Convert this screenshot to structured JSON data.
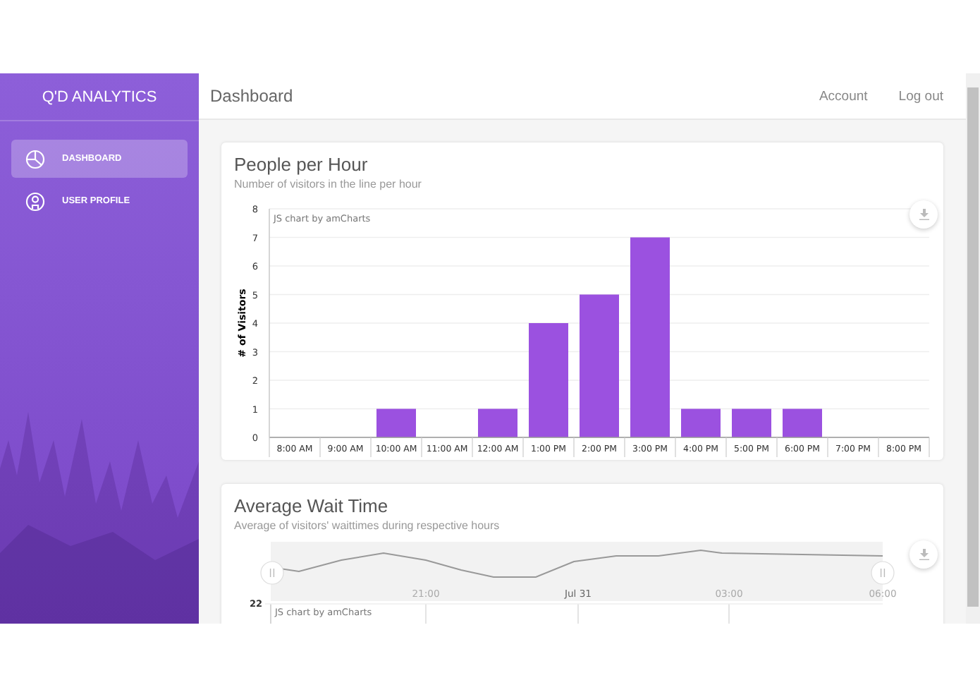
{
  "sidebar": {
    "brand": "Q'D ANALYTICS",
    "items": [
      {
        "label": "DASHBOARD",
        "kind": "pie",
        "selected": true
      },
      {
        "label": "USER PROFILE",
        "kind": "user",
        "selected": false
      }
    ]
  },
  "header": {
    "title": "Dashboard",
    "links": [
      "Account",
      "Log out"
    ]
  },
  "cards": [
    {
      "kind": "bar",
      "title": "People per Hour",
      "subtitle": "Number of visitors in the line per hour",
      "credit": "JS chart by amCharts",
      "chart_data": {
        "type": "bar",
        "ylabel": "# of Visitors",
        "categories": [
          "8:00 AM",
          "9:00 AM",
          "10:00 AM",
          "11:00 AM",
          "12:00 AM",
          "1:00 PM",
          "2:00 PM",
          "3:00 PM",
          "4:00 PM",
          "5:00 PM",
          "6:00 PM",
          "7:00 PM",
          "8:00 PM"
        ],
        "values": [
          0,
          0,
          1,
          0,
          1,
          4,
          5,
          7,
          1,
          1,
          1,
          0,
          0
        ],
        "ylim": [
          0,
          8
        ],
        "yticks": [
          0,
          1,
          2,
          3,
          4,
          5,
          6,
          7,
          8
        ],
        "grid": true
      }
    },
    {
      "kind": "timeline",
      "title": "Average Wait Time",
      "subtitle": "Average of visitors' waittimes during respective hours",
      "credit": "JS chart by amCharts",
      "y_tick": "22",
      "time_labels": [
        "21:00",
        "Jul 31",
        "03:00",
        "06:00"
      ]
    }
  ]
}
